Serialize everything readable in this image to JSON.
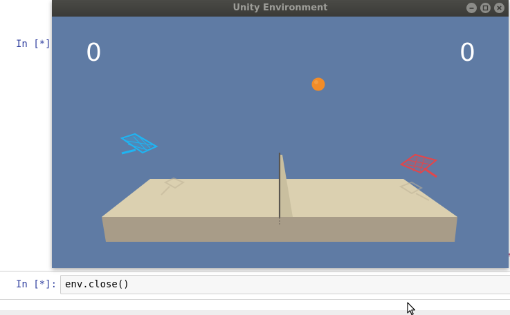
{
  "notebook": {
    "cells": [
      {
        "prompt": "In [*]:",
        "code": ""
      },
      {
        "prompt": "In [*]:",
        "code": "env.close()"
      }
    ],
    "prompt_color": "#303f9f"
  },
  "unity_window": {
    "title": "Unity Environment",
    "background_color": "#5f7ba4",
    "controls": [
      "minimize-icon",
      "maximize-icon",
      "close-icon"
    ]
  },
  "game": {
    "score_left": "0",
    "score_right": "0",
    "ball_color": "#f28c28",
    "left_racket_color": "#1fb4f2",
    "right_racket_color": "#e0474c"
  },
  "right_edge_mark": "≡"
}
